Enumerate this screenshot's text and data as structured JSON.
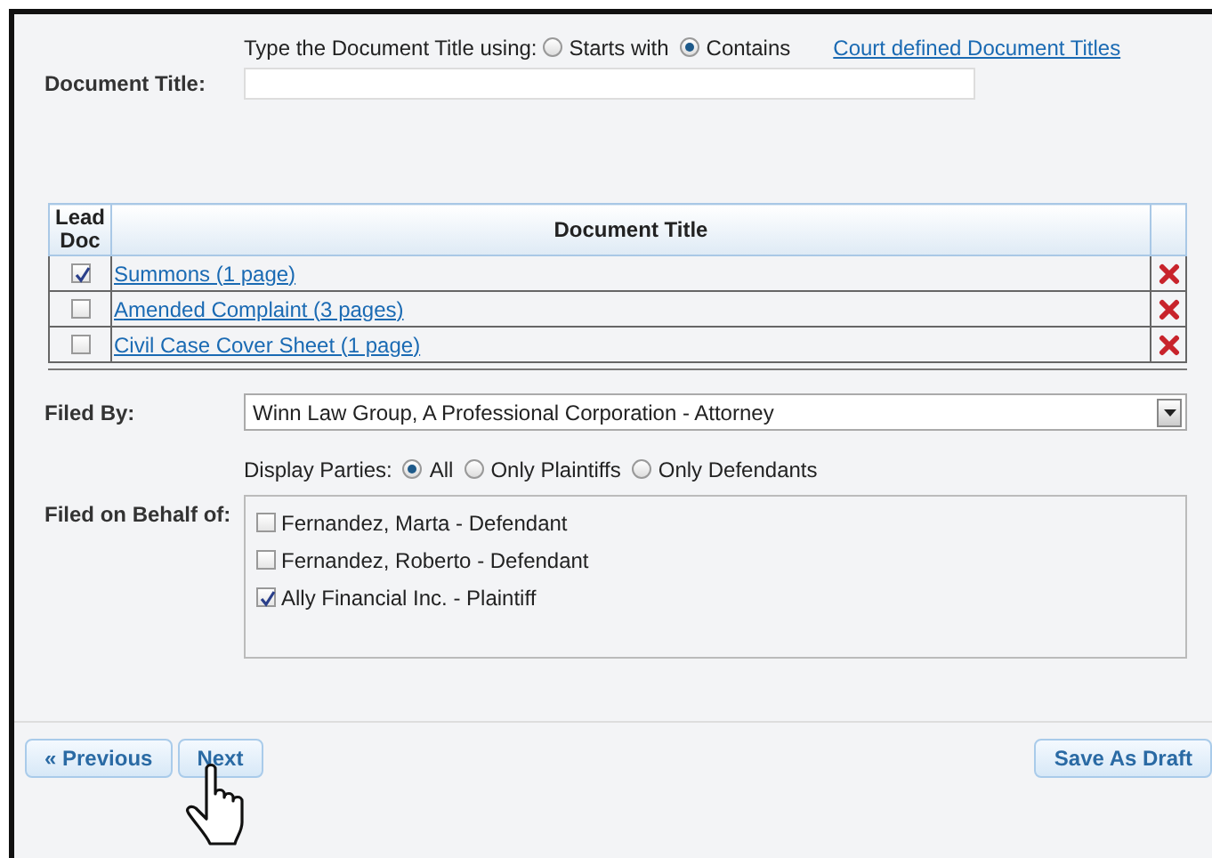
{
  "document_title": {
    "label": "Document Title:",
    "search_mode_label": "Type the Document Title using:",
    "search_modes": [
      {
        "label": "Starts with",
        "selected": false
      },
      {
        "label": "Contains",
        "selected": true
      }
    ],
    "court_titles_link": "Court defined Document Titles"
  },
  "documents_table": {
    "columns": [
      "Lead Doc",
      "Document Title"
    ],
    "rows": [
      {
        "lead": true,
        "title": "Summons (1 page)"
      },
      {
        "lead": false,
        "title": "Amended Complaint (3 pages)"
      },
      {
        "lead": false,
        "title": "Civil Case Cover Sheet (1 page)"
      }
    ]
  },
  "filed_by": {
    "label": "Filed By:",
    "value": "Winn Law Group, A Professional Corporation - Attorney"
  },
  "display_parties": {
    "label": "Display Parties:",
    "options": [
      {
        "label": "All",
        "selected": true
      },
      {
        "label": "Only Plaintiffs",
        "selected": false
      },
      {
        "label": "Only Defendants",
        "selected": false
      }
    ]
  },
  "filed_on_behalf": {
    "label": "Filed on Behalf of:",
    "parties": [
      {
        "label": "Fernandez, Marta - Defendant",
        "checked": false
      },
      {
        "label": "Fernandez, Roberto - Defendant",
        "checked": false
      },
      {
        "label": "Ally Financial Inc. - Plaintiff",
        "checked": true
      }
    ]
  },
  "buttons": {
    "previous": "« Previous",
    "next": "Next",
    "save_draft": "Save As Draft"
  }
}
